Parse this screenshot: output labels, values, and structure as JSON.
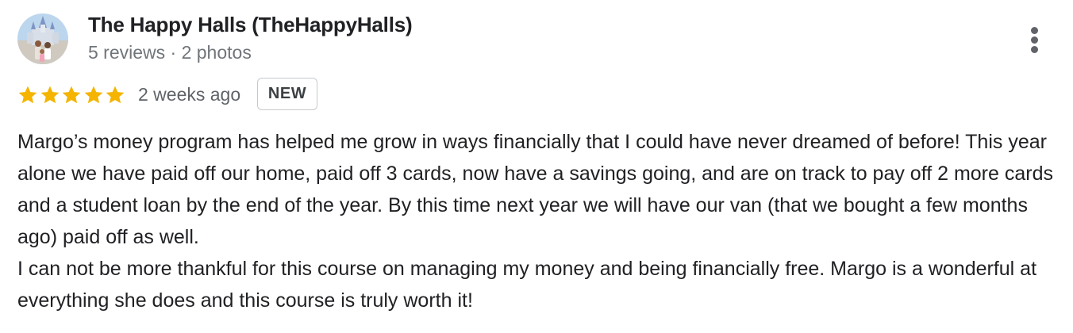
{
  "author": {
    "name": "The Happy Halls (TheHappyHalls)",
    "meta": "5 reviews · 2 photos",
    "avatar_icon": "profile-photo"
  },
  "more_menu": {
    "icon": "more-vertical-icon"
  },
  "rating": {
    "stars": 5,
    "max_stars": 5,
    "star_color": "#f4b400",
    "time_ago": "2 weeks ago",
    "badge": "NEW"
  },
  "review": {
    "paragraph1": "Margo’s money program has helped me grow in ways financially that I could have never dreamed of before! This year alone we have paid off our home, paid off 3 cards, now have a savings going, and are on track to pay off 2 more cards and a student loan by the end of the year. By this time next year we will have our van (that we bought a few months ago) paid off as well.",
    "paragraph2": "I can not be more thankful for this course on managing my money and being financially free. Margo is a wonderful at everything she does and this course is truly worth it!"
  }
}
